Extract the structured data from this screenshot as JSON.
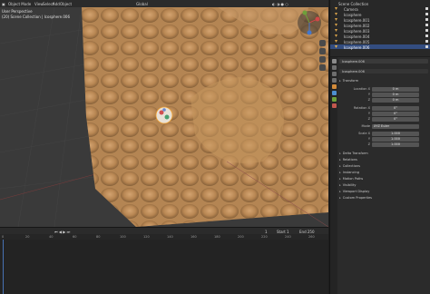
{
  "viewport_header": {
    "mode": "Object Mode",
    "menu": [
      "View",
      "Select",
      "Add",
      "Object"
    ],
    "transform": "Global"
  },
  "viewport_overlay": {
    "line1": "User Perspective",
    "line2": "(20) Scene Collection | Icosphere.006"
  },
  "outliner": {
    "title": "Scene Collection",
    "items": [
      {
        "label": "Camera",
        "color": "#d6a14a"
      },
      {
        "label": "Icosphere",
        "color": "#d6a14a"
      },
      {
        "label": "Icosphere.001",
        "color": "#d6a14a"
      },
      {
        "label": "Icosphere.002",
        "color": "#d6a14a"
      },
      {
        "label": "Icosphere.003",
        "color": "#d6a14a"
      },
      {
        "label": "Icosphere.004",
        "color": "#d6a14a"
      },
      {
        "label": "Icosphere.005",
        "color": "#d6a14a"
      },
      {
        "label": "Icosphere.006",
        "color": "#e8b24a",
        "selected": true
      }
    ]
  },
  "properties": {
    "object_name": "Icosphere.006",
    "section_transform": "Transform",
    "location_label": "Location X",
    "location": [
      "0 m",
      "0 m",
      "0 m"
    ],
    "rotation_label": "Rotation X",
    "rotation": [
      "0°",
      "0°",
      "0°"
    ],
    "mode_label": "Mode",
    "mode_value": "XYZ Euler",
    "scale_label": "Scale X",
    "scale": [
      "1.000",
      "1.000",
      "1.000"
    ],
    "axis_labels": [
      "Y",
      "Z"
    ],
    "sections": [
      "Delta Transform",
      "Relations",
      "Collections",
      "Instancing",
      "Motion Paths",
      "Visibility",
      "Viewport Display",
      "Custom Properties"
    ]
  },
  "timeline": {
    "ticks": [
      "0",
      "20",
      "40",
      "60",
      "80",
      "100",
      "120",
      "140",
      "160",
      "180",
      "200",
      "220",
      "240",
      "260"
    ],
    "current_frame": "1",
    "start": "Start 1",
    "end": "End 250"
  },
  "colors": {
    "sculpt": "#c08e58",
    "accent": "#4772b3"
  }
}
